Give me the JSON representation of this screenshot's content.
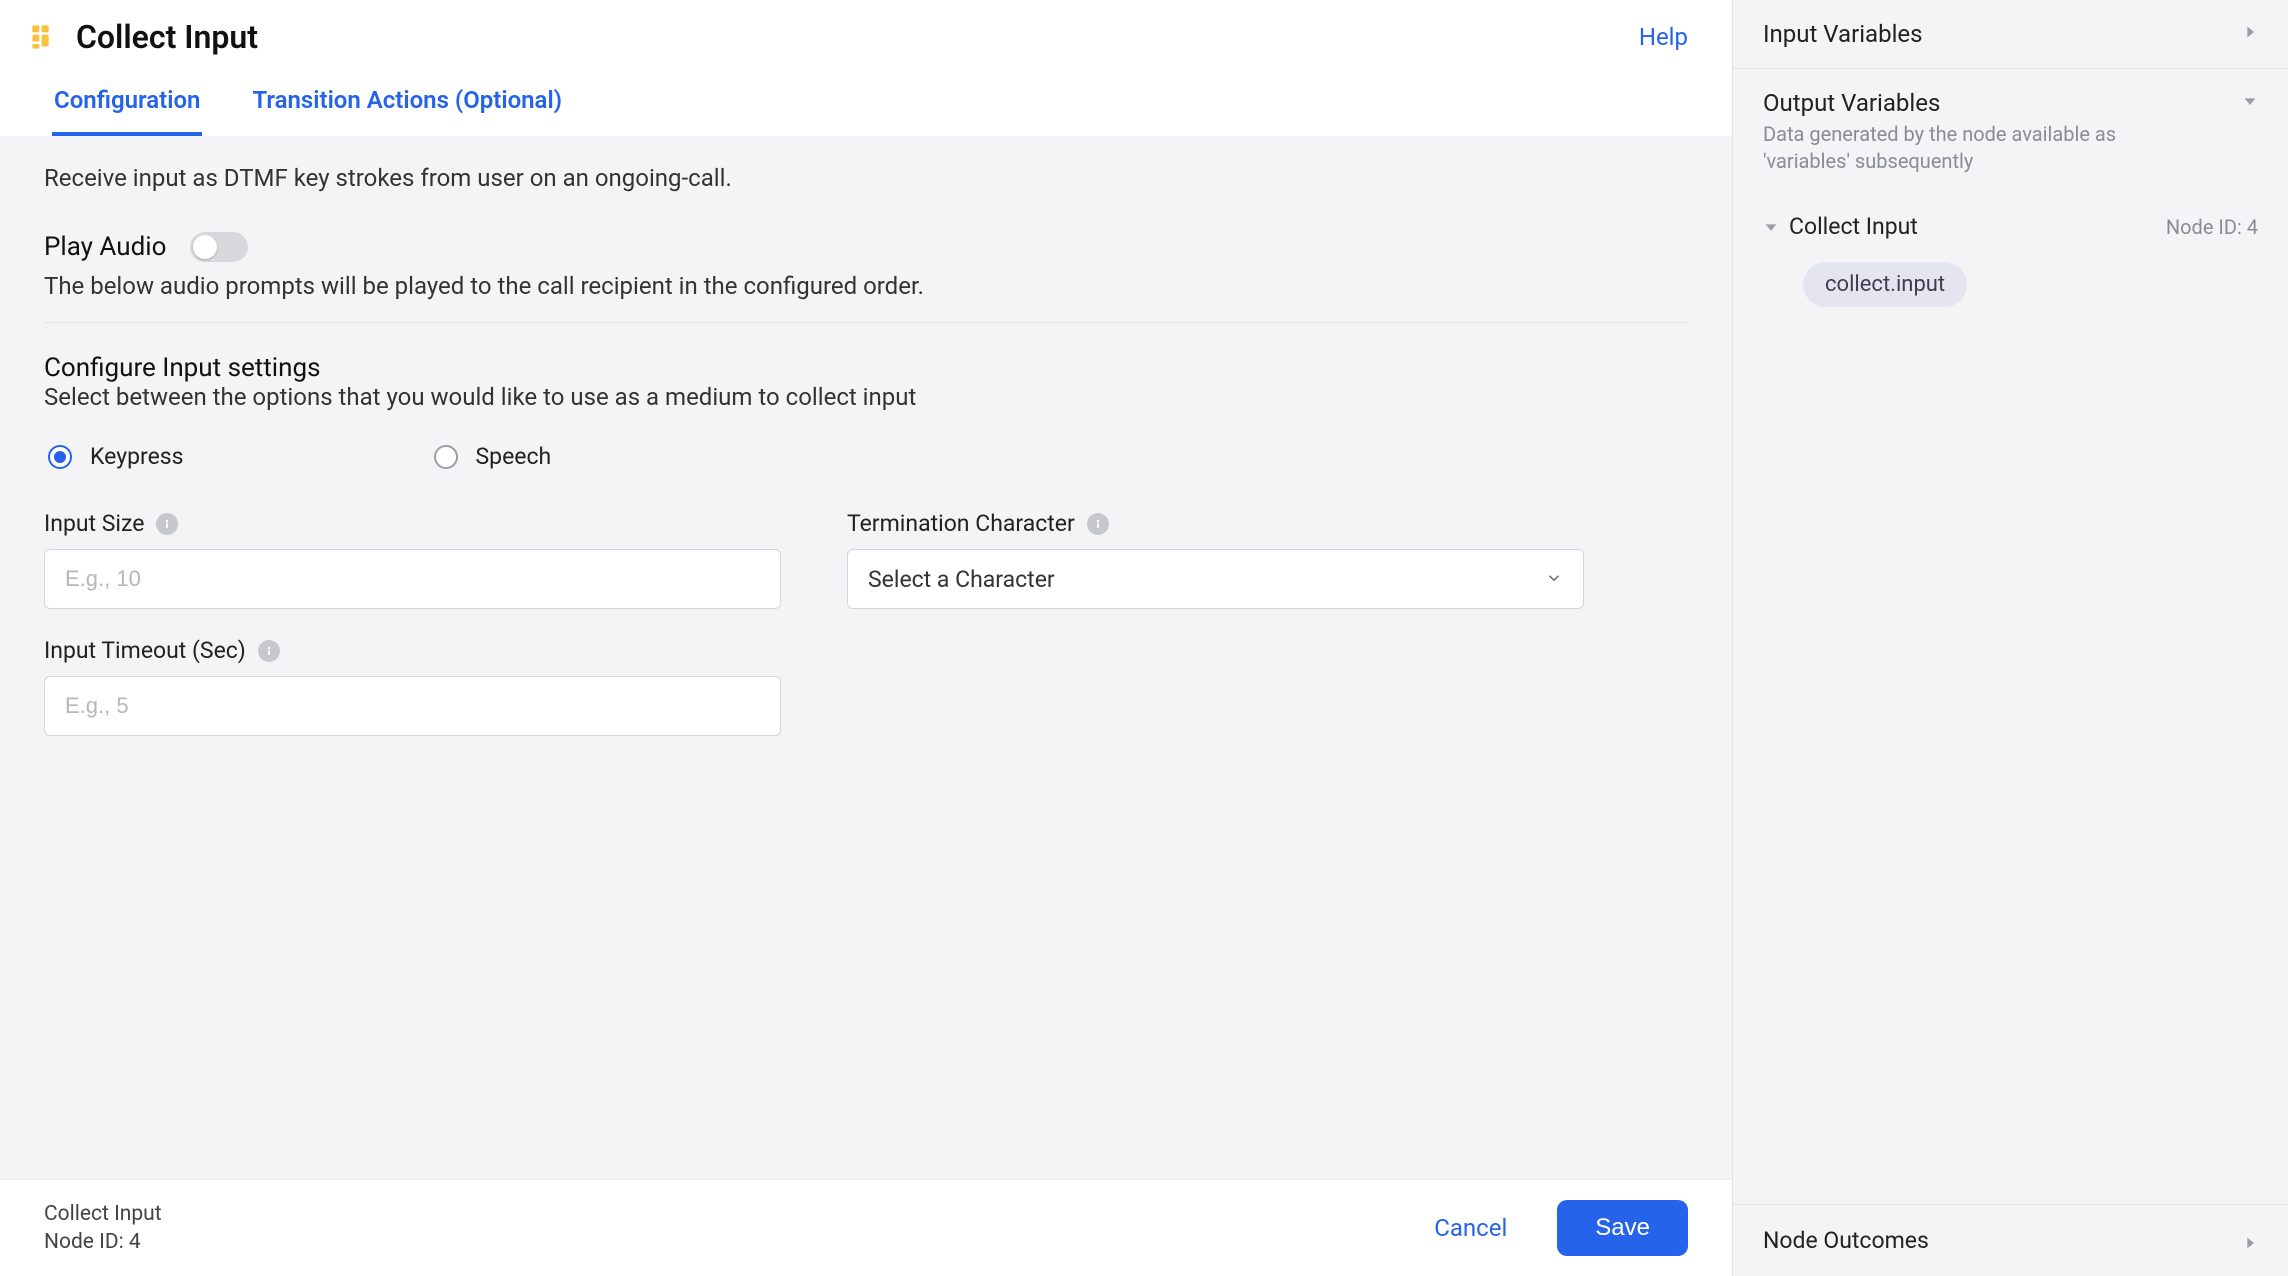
{
  "header": {
    "title": "Collect Input",
    "help_label": "Help"
  },
  "tabs": {
    "configuration": "Configuration",
    "transition_actions": "Transition Actions (Optional)"
  },
  "content": {
    "description": "Receive input as DTMF key strokes from user on an ongoing-call.",
    "play_audio": {
      "title": "Play Audio",
      "sub": "The below audio prompts will be played to the call recipient in the configured order."
    },
    "configure": {
      "title": "Configure Input settings",
      "sub": "Select between the options that you would like to use as a medium to collect input"
    },
    "radios": {
      "keypress": "Keypress",
      "speech": "Speech"
    },
    "fields": {
      "input_size": {
        "label": "Input Size",
        "placeholder": "E.g., 10"
      },
      "termination": {
        "label": "Termination Character",
        "placeholder": "Select a Character"
      },
      "timeout": {
        "label": "Input Timeout (Sec)",
        "placeholder": "E.g., 5"
      }
    }
  },
  "footer": {
    "node_name": "Collect Input",
    "node_id": "Node ID: 4",
    "cancel": "Cancel",
    "save": "Save"
  },
  "sidebar": {
    "input_vars": {
      "title": "Input Variables"
    },
    "output_vars": {
      "title": "Output Variables",
      "sub": "Data generated by the node available as 'variables' subsequently"
    },
    "node": {
      "name": "Collect Input",
      "id_label": "Node ID: 4",
      "chip": "collect.input"
    },
    "outcomes": {
      "title": "Node Outcomes"
    }
  }
}
